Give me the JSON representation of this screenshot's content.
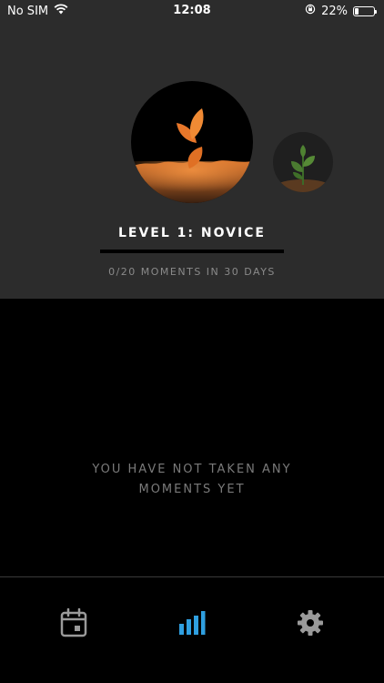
{
  "status_bar": {
    "carrier": "No SIM",
    "time": "12:08",
    "battery": "22%",
    "battery_level": 0.22
  },
  "level": {
    "title": "LEVEL 1: NOVICE",
    "moments_progress_text": "0/20 MOMENTS IN 30 DAYS",
    "moments_done": 0,
    "moments_goal": 20,
    "current_icon": "sprout-seed-icon",
    "next_icon": "plant-icon"
  },
  "main": {
    "empty_message": "YOU HAVE NOT TAKEN ANY MOMENTS YET"
  },
  "tab_bar": {
    "tabs": [
      {
        "name": "calendar",
        "icon": "calendar-icon",
        "active": false
      },
      {
        "name": "stats",
        "icon": "bar-chart-icon",
        "active": true
      },
      {
        "name": "settings",
        "icon": "gear-icon",
        "active": false
      }
    ]
  },
  "colors": {
    "header_bg": "#2c2c2c",
    "accent_orange": "#e8833a",
    "active_tab": "#2f9fe0",
    "inactive_tab": "#9a9a9a"
  }
}
